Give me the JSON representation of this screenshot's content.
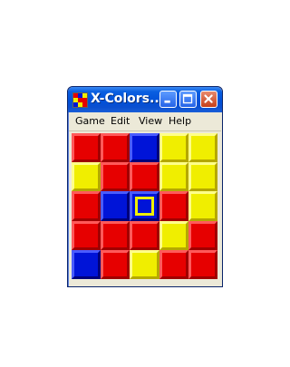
{
  "window": {
    "title": "X-Colors...",
    "icons": {
      "app": "app-grid-icon",
      "minimize": "minimize-icon",
      "maximize": "maximize-icon",
      "close": "close-icon"
    }
  },
  "menu": {
    "game": "Game",
    "edit": "Edit",
    "view": "View",
    "help": "Help"
  },
  "board": {
    "rows": 5,
    "cols": 5,
    "tiles": [
      [
        "red",
        "red",
        "blue",
        "yellow",
        "yellow"
      ],
      [
        "yellow",
        "red",
        "red",
        "yellow",
        "yellow"
      ],
      [
        "red",
        "blue",
        "blue",
        "red",
        "yellow"
      ],
      [
        "red",
        "red",
        "red",
        "yellow",
        "red"
      ],
      [
        "blue",
        "red",
        "yellow",
        "red",
        "red"
      ]
    ],
    "selected": {
      "row": 2,
      "col": 2
    },
    "colors": {
      "red": "#e60000",
      "blue": "#0014d8",
      "yellow": "#f0ee00"
    }
  }
}
